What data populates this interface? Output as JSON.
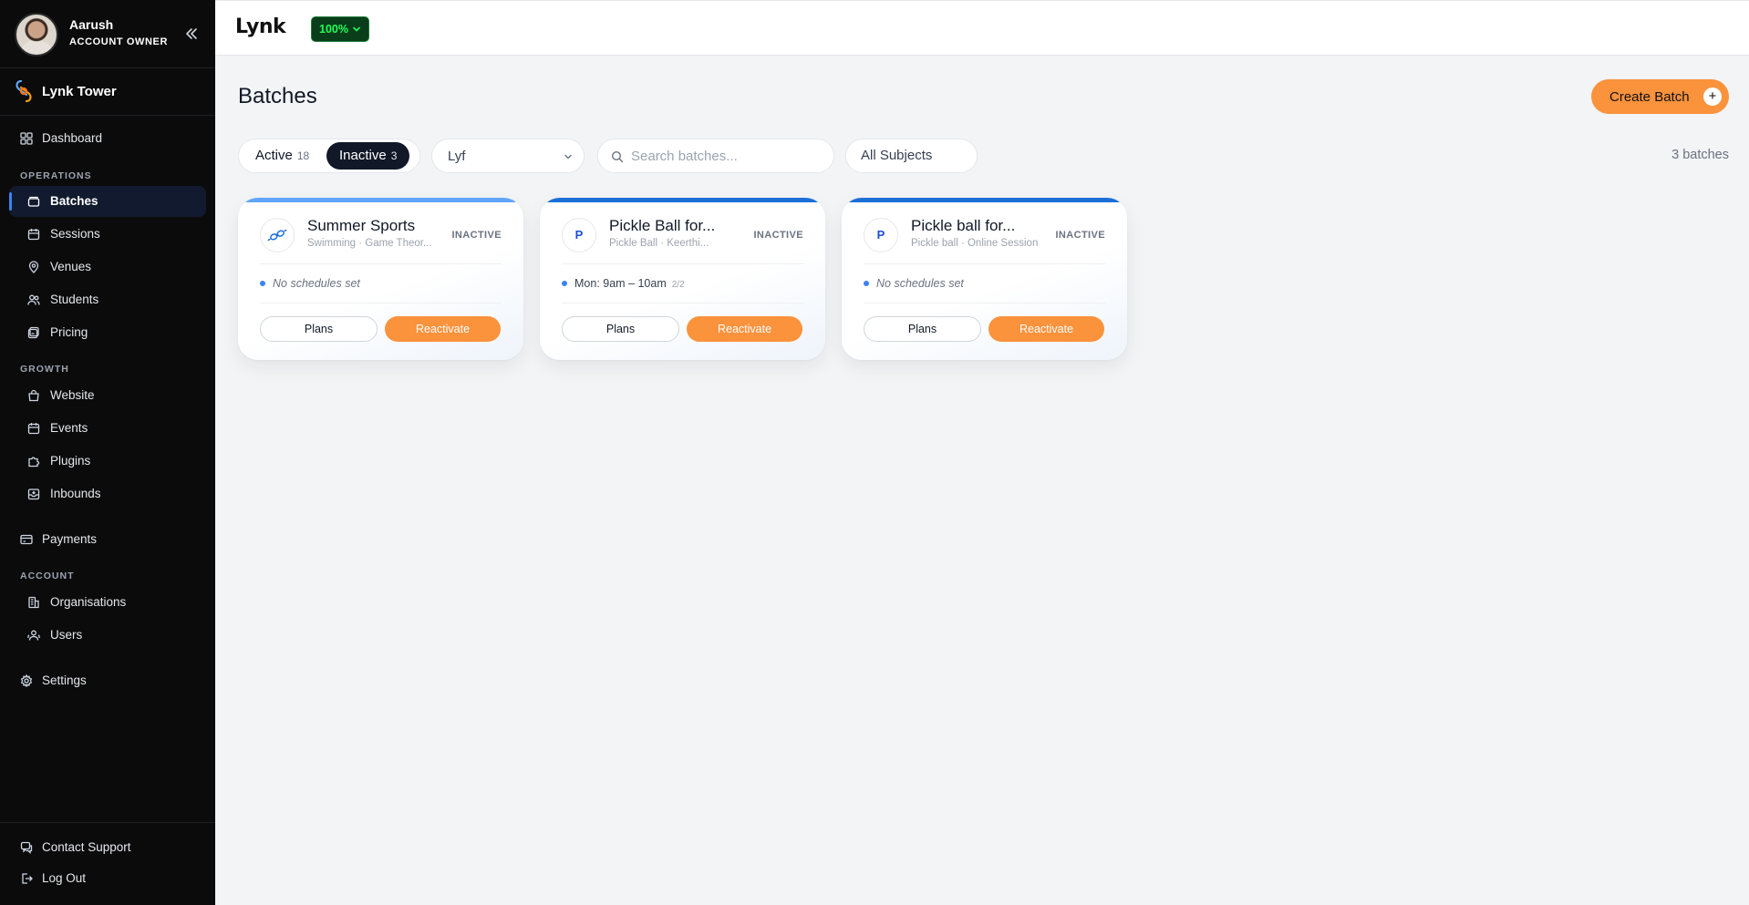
{
  "profile": {
    "name": "Aarush",
    "role": "ACCOUNT OWNER"
  },
  "org": {
    "name": "Lynk Tower"
  },
  "nav": {
    "dashboard": "Dashboard",
    "operations_header": "OPERATIONS",
    "batches": "Batches",
    "sessions": "Sessions",
    "venues": "Venues",
    "students": "Students",
    "pricing": "Pricing",
    "growth_header": "GROWTH",
    "website": "Website",
    "events": "Events",
    "plugins": "Plugins",
    "inbounds": "Inbounds",
    "payments": "Payments",
    "account_header": "ACCOUNT",
    "organisations": "Organisations",
    "users": "Users",
    "settings": "Settings",
    "contact_support": "Contact Support",
    "log_out": "Log Out"
  },
  "topbar": {
    "logo": "Lynk",
    "percent": "100%"
  },
  "main": {
    "title": "Batches",
    "create_label": "Create Batch",
    "create_plus": "+",
    "tabs": [
      {
        "label": "Active",
        "count": "18"
      },
      {
        "label": "Inactive",
        "count": "3"
      }
    ],
    "venue_selected": "Lyf",
    "search_placeholder": "Search batches...",
    "subjects": "All Subjects",
    "batch_count": "3 batches"
  },
  "cards": [
    {
      "title": "Summer Sports",
      "subtitle": "Swimming · Game Theor...",
      "badge": "INACTIVE",
      "initial": "",
      "schedule_none": "No schedules set",
      "schedule": "",
      "slots": "",
      "plans": "Plans",
      "action": "Reactivate",
      "bar_color": "#60a5fa"
    },
    {
      "title": "Pickle Ball for...",
      "subtitle": "Pickle Ball · Keerthi...",
      "badge": "INACTIVE",
      "initial": "P",
      "schedule_none": "",
      "schedule": "Mon: 9am – 10am",
      "slots": "2/2",
      "plans": "Plans",
      "action": "Reactivate",
      "bar_color": "#1d6fd8"
    },
    {
      "title": "Pickle ball for...",
      "subtitle": "Pickle ball · Online Session",
      "badge": "INACTIVE",
      "initial": "P",
      "schedule_none": "No schedules set",
      "schedule": "",
      "slots": "",
      "plans": "Plans",
      "action": "Reactivate",
      "bar_color": "#1d6fd8"
    }
  ],
  "colors": {
    "accent": "#fb923c",
    "sidebar": "#0b0b0c",
    "active_indicator": "#3b82f6",
    "percent_text": "#22ff5a"
  }
}
